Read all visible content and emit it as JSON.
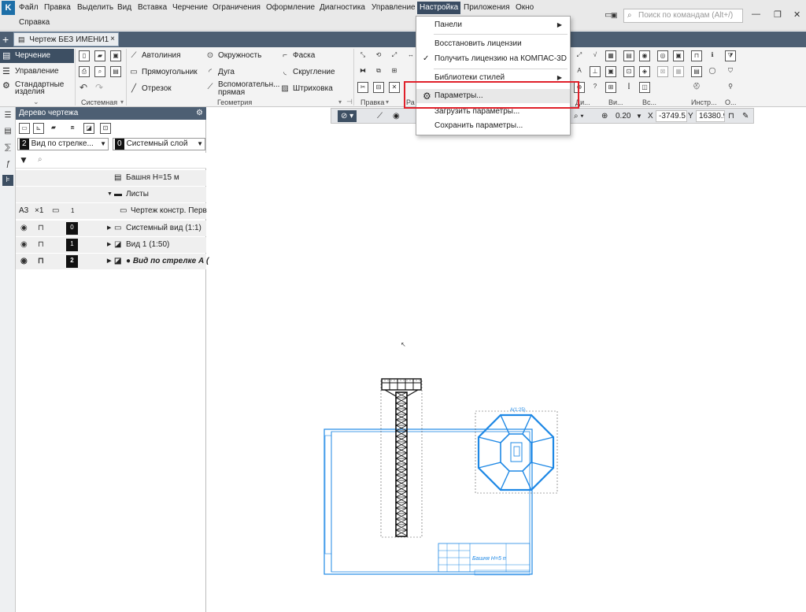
{
  "menu": {
    "items": [
      "Файл",
      "Правка",
      "Выделить",
      "Вид",
      "Вставка",
      "Черчение",
      "Ограничения",
      "Оформление",
      "Диагностика",
      "Управление",
      "Настройка",
      "Приложения",
      "Окно"
    ],
    "second_row": "Справка",
    "active": "Настройка",
    "search_placeholder": "Поиск по командам (Alt+/)"
  },
  "document_tab": {
    "title": "Чертеж БЕЗ ИМЕНИ1",
    "close": "×"
  },
  "ribbon": {
    "side_tabs": [
      "Черчение",
      "Управление",
      "Стандартные изделия"
    ],
    "tools": [
      "Автолиния",
      "Окружность",
      "Фаска",
      "Прямоугольник",
      "Дуга",
      "Скругление",
      "Отрезок",
      "Вспомогательн... прямая",
      "Штриховка"
    ],
    "groups": [
      "Системная",
      "Геометрия",
      "Правка",
      "Ра",
      "Ди...",
      "Ви...",
      "Вс...",
      "Инстр...",
      "О..."
    ]
  },
  "tree": {
    "title": "Дерево чертежа",
    "view_select": {
      "num": "2",
      "label": "Вид по стрелке..."
    },
    "layer_select": {
      "num": "0",
      "label": "Системный слой"
    },
    "search_placeholder": "",
    "root": "Башня Н=15 м",
    "sheets": "Листы",
    "sheet_format": "А3",
    "sheet_mult": "×1",
    "sheet_num": "1",
    "sheet_name": "Чертеж констр. Перв",
    "views": [
      {
        "num": "0",
        "label": "Системный вид (1:1)"
      },
      {
        "num": "1",
        "label": "Вид 1 (1:50)"
      },
      {
        "num": "2",
        "label": "● Вид по стрелке А ("
      }
    ]
  },
  "settings_menu": {
    "items": [
      "Панели",
      "Восстановить лицензии",
      "Получить лицензию на КОМПАС-3D",
      "Библиотеки стилей",
      "Параметры...",
      "Загрузить параметры...",
      "Сохранить параметры..."
    ],
    "checked": "Получить лицензию на КОМПАС-3D",
    "highlighted": "Параметры..."
  },
  "canvas_toolbar": {
    "zoom": "0.20",
    "x_label": "X",
    "x_value": "-3749.5",
    "y_label": "Y",
    "y_value": "16380.9"
  },
  "drawing": {
    "title_block_text": "Башня Н=5 п",
    "view_label": "А(1:25)"
  },
  "colors": {
    "accent_blue": "#1e88e5",
    "header": "#4d5f73",
    "highlight": "#e0202a"
  }
}
